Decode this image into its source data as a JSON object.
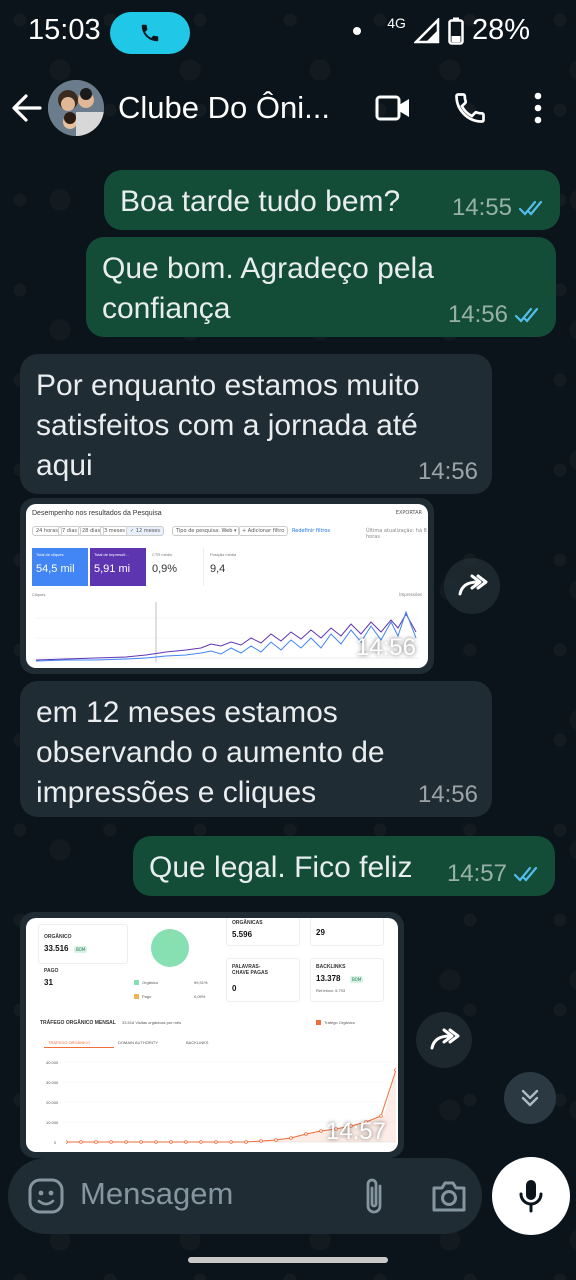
{
  "status_bar": {
    "time": "15:03",
    "network": "4G",
    "battery": "28%"
  },
  "header": {
    "title": "Clube Do Ôni..."
  },
  "messages": [
    {
      "text": "Boa tarde tudo bem?",
      "time": "14:55"
    },
    {
      "text": "Que bom. Agradeço pela confiança",
      "time": "14:56"
    },
    {
      "text": "Por enquanto estamos muito satisfeitos com a jornada até aqui",
      "time": "14:56"
    },
    {
      "time": "14:56"
    },
    {
      "text": "em 12 meses estamos observando o aumento de impressões e cliques",
      "time": "14:56"
    },
    {
      "text": "Que legal. Fico feliz",
      "time": "14:57"
    },
    {
      "time": "14:57"
    }
  ],
  "screenshot_1": {
    "title": "Desempenho nos resultados da Pesquisa",
    "export_label": "EXPORTAR",
    "filters": [
      "24 horas",
      "7 dias",
      "28 dias",
      "3 meses",
      "✓ 12 meses",
      "Tipo de pesquisa: Web ▾",
      "+ Adicionar filtro"
    ],
    "reset_label": "Redefinir filtros",
    "updated_label": "Última atualização: há 8 horas",
    "metrics": [
      {
        "label": "Total de cliques",
        "value": "54,5 mil"
      },
      {
        "label": "Total de impressõ...",
        "value": "5,91 mi"
      },
      {
        "label": "CTR médio",
        "value": "0,9%"
      },
      {
        "label": "Posição média",
        "value": "9,4"
      }
    ],
    "chart_left_label": "Cliques",
    "chart_right_label": "Impressões"
  },
  "screenshot_2": {
    "organico_label": "ORGÂNICO",
    "organico_value": "33.516",
    "organico_badge": "BOM",
    "pago_label": "PAGO",
    "pago_value": "31",
    "organicas_label": "ORGÂNICAS",
    "organicas_value": "5.596",
    "backlinks_value": "29",
    "legend_organico": "Orgânico",
    "legend_organico_pct": "99,91%",
    "legend_pago": "Pago",
    "legend_pago_pct": "0,09%",
    "palavras_label": "PALAVRAS-CHAVE PAGAS",
    "palavras_value": "0",
    "backlinks_label": "BACKLINKS",
    "backlinks2_value": "13.378",
    "backlinks2_badge": "BOM",
    "ref_domains": "Ref.inbox: 5.793",
    "traffic_title": "TRÁFEGO ORGÂNICO MENSAL",
    "traffic_sub": "33.516 Visitas orgânicas por mês",
    "traffic_legend": "Tráfego Orgânico",
    "tabs": [
      "TRÁFEGO ORGÂNICO",
      "DOMAIN AUTHORITY",
      "BACKLINKS"
    ],
    "y_ticks": [
      "40.000",
      "30.000",
      "20.000",
      "10.000",
      "0"
    ]
  },
  "input": {
    "placeholder": "Mensagem"
  },
  "colors": {
    "outgoing_bubble": "#134d37",
    "incoming_bubble": "#202c33",
    "read_ticks": "#53bdeb",
    "call_pill": "#21c7e6"
  }
}
